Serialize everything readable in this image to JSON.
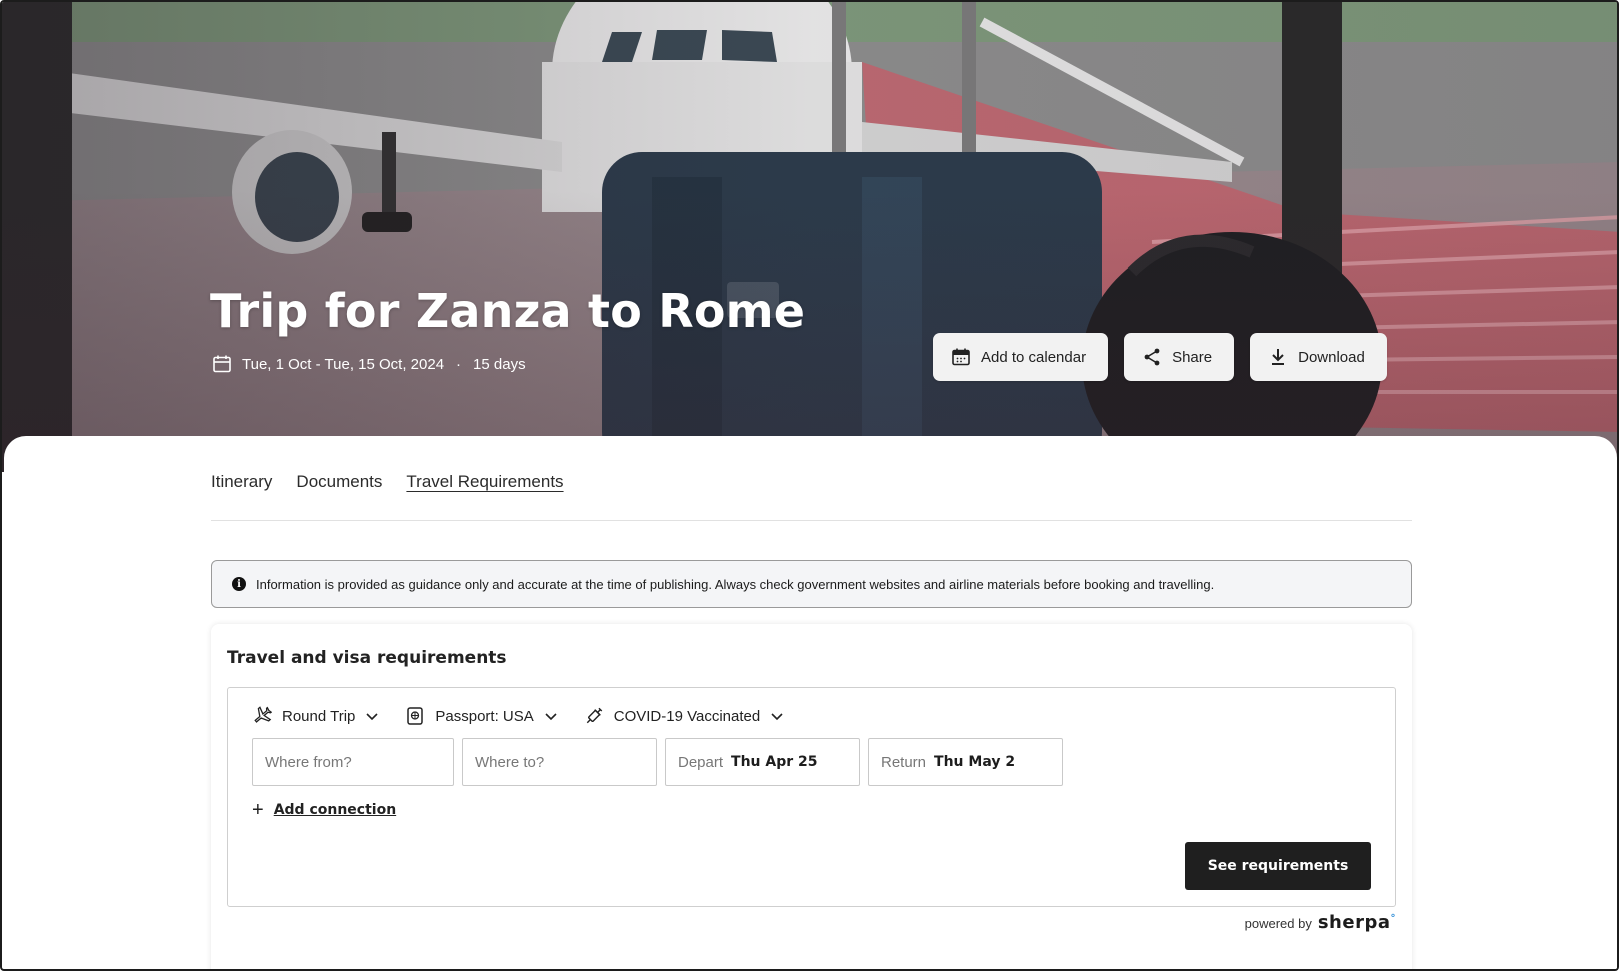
{
  "trip": {
    "title": "Trip for Zanza to Rome",
    "dates": "Tue, 1 Oct - Tue, 15 Oct, 2024",
    "separator": "·",
    "duration": "15 days"
  },
  "actions": {
    "add_to_calendar": "Add to calendar",
    "share": "Share",
    "download": "Download"
  },
  "tabs": [
    {
      "label": "Itinerary",
      "active": false
    },
    {
      "label": "Documents",
      "active": false
    },
    {
      "label": "Travel Requirements",
      "active": true
    }
  ],
  "notice": {
    "icon": "info-icon",
    "text": "Information is provided as guidance only and accurate at the time of publishing. Always check government websites and airline materials before booking and travelling."
  },
  "requirements": {
    "title": "Travel and visa requirements",
    "filters": {
      "trip_type": "Round Trip",
      "passport": "Passport: USA",
      "vaccination": "COVID-19 Vaccinated"
    },
    "fields": {
      "from_placeholder": "Where from?",
      "to_placeholder": "Where to?",
      "depart_label": "Depart",
      "depart_value": "Thu Apr 25",
      "return_label": "Return",
      "return_value": "Thu May 2"
    },
    "add_connection": "Add connection",
    "submit": "See requirements",
    "powered_by": "powered by",
    "brand": "sherpa",
    "brand_mark": "°"
  },
  "colors": {
    "dark_button": "#1f1f1f",
    "brand_accent": "#2a8bd6",
    "notice_bg": "#f4f5f7"
  }
}
